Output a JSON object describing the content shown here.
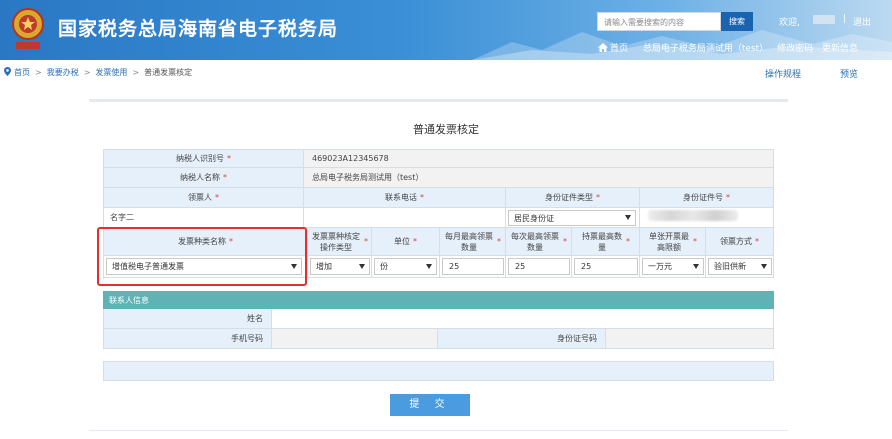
{
  "header": {
    "title": "国家税务总局海南省电子税务局",
    "search_placeholder": "请输入需要搜索的内容",
    "search_button": "搜索",
    "welcome": "欢迎,",
    "separator": "|",
    "logout": "退出",
    "nav": {
      "home": "首页",
      "taxpayer": "总局电子税务局测试用（test）",
      "change_password": "修改密码",
      "update_info": "更新信息"
    }
  },
  "breadcrumb": {
    "items": [
      "首页",
      "我要办税",
      "发票使用",
      "普通发票核定"
    ],
    "separator": ">"
  },
  "actions": {
    "guide": "操作规程",
    "preview": "预览"
  },
  "form": {
    "title": "普通发票核定",
    "required_mark": "*",
    "taxpayer_id_label": "纳税人识别号",
    "taxpayer_id": "469023A12345678",
    "taxpayer_name_label": "纳税人名称",
    "taxpayer_name": "总局电子税务局测试用（test）",
    "receiver_label": "领票人",
    "phone_label": "联系电话",
    "id_type_label": "身份证件类型",
    "id_number_label": "身份证件号",
    "receiver_value": "名字二",
    "id_type_value": "居民身份证",
    "invoice_headers": {
      "type": "发票种类名称",
      "op_type": "发票票种核定操作类型",
      "unit": "单位",
      "monthly_max": "每月最高领票数量",
      "each_max": "每次最高领票数量",
      "hold_max": "持票最高数量",
      "single_limit": "单张开票最高限额",
      "method": "领票方式"
    },
    "invoice_row": {
      "type": "增值税电子普通发票",
      "op_type": "增加",
      "unit": "份",
      "monthly_max": "25",
      "each_max": "25",
      "hold_max": "25",
      "single_limit": "一万元",
      "method": "验旧供新"
    }
  },
  "contact": {
    "section_title": "联系人信息",
    "name_label": "姓名",
    "phone_label": "手机号码",
    "id_label": "身份证号码"
  },
  "submit_label": "提 交",
  "colors": {
    "header_blue": "#2a78c4",
    "label_bg": "#e6f0fa",
    "section_teal": "#5fb3b5",
    "submit_blue": "#4a9be0",
    "highlight_red": "#e03030"
  }
}
